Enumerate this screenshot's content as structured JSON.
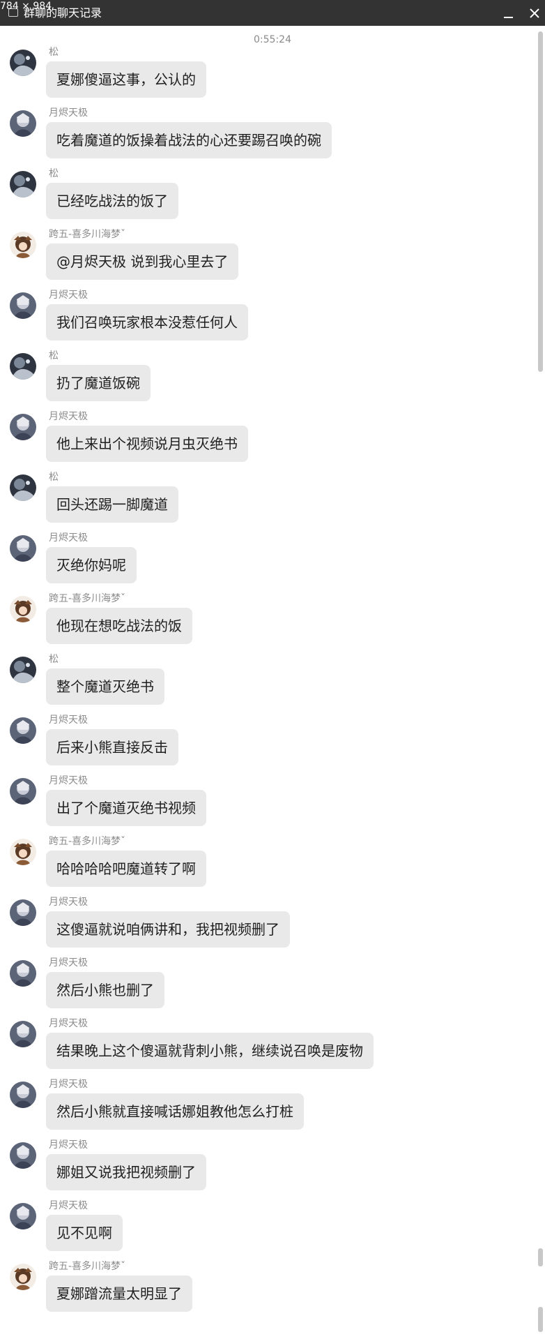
{
  "window": {
    "dimension_label": "784 × 984",
    "title": "群聊的聊天记录",
    "minimize_label": "minimize",
    "close_label": "close"
  },
  "chat": {
    "timestamp": "0:55:24",
    "messages": [
      {
        "sender": "松",
        "avatar": "song",
        "text": "夏娜傻逼这事，公认的"
      },
      {
        "sender": "月烬天极",
        "avatar": "yuejin",
        "text": "吃着魔道的饭操着战法的心还要踢召唤的碗"
      },
      {
        "sender": "松",
        "avatar": "song",
        "text": "已经吃战法的饭了"
      },
      {
        "sender": "跨五-喜多川海梦ˇ",
        "avatar": "kuawu",
        "text": "@月烬天极 说到我心里去了"
      },
      {
        "sender": "月烬天极",
        "avatar": "yuejin",
        "text": "我们召唤玩家根本没惹任何人"
      },
      {
        "sender": "松",
        "avatar": "song",
        "text": "扔了魔道饭碗"
      },
      {
        "sender": "月烬天极",
        "avatar": "yuejin",
        "text": "他上来出个视频说月虫灭绝书"
      },
      {
        "sender": "松",
        "avatar": "song",
        "text": "回头还踢一脚魔道"
      },
      {
        "sender": "月烬天极",
        "avatar": "yuejin",
        "text": "灭绝你妈呢"
      },
      {
        "sender": "跨五-喜多川海梦ˇ",
        "avatar": "kuawu",
        "text": "他现在想吃战法的饭"
      },
      {
        "sender": "松",
        "avatar": "song",
        "text": "整个魔道灭绝书"
      },
      {
        "sender": "月烬天极",
        "avatar": "yuejin",
        "text": "后来小熊直接反击"
      },
      {
        "sender": "月烬天极",
        "avatar": "yuejin",
        "text": "出了个魔道灭绝书视频"
      },
      {
        "sender": "跨五-喜多川海梦ˇ",
        "avatar": "kuawu",
        "text": "哈哈哈哈吧魔道转了啊"
      },
      {
        "sender": "月烬天极",
        "avatar": "yuejin",
        "text": "这傻逼就说咱俩讲和，我把视频删了"
      },
      {
        "sender": "月烬天极",
        "avatar": "yuejin",
        "text": "然后小熊也删了"
      },
      {
        "sender": "月烬天极",
        "avatar": "yuejin",
        "text": "结果晚上这个傻逼就背刺小熊，继续说召唤是废物"
      },
      {
        "sender": "月烬天极",
        "avatar": "yuejin",
        "text": "然后小熊就直接喊话娜姐教他怎么打桩"
      },
      {
        "sender": "月烬天极",
        "avatar": "yuejin",
        "text": "娜姐又说我把视频删了"
      },
      {
        "sender": "月烬天极",
        "avatar": "yuejin",
        "text": "见不见啊"
      },
      {
        "sender": "跨五-喜多川海梦ˇ",
        "avatar": "kuawu",
        "text": "夏娜蹭流量太明显了"
      }
    ]
  },
  "colors": {
    "titlebar_bg": "#333333",
    "bubble_bg": "#e9e9e9",
    "text": "#1f1f1f",
    "meta_text": "#8c8c8c",
    "scrollbar": "#c8c8c8"
  }
}
